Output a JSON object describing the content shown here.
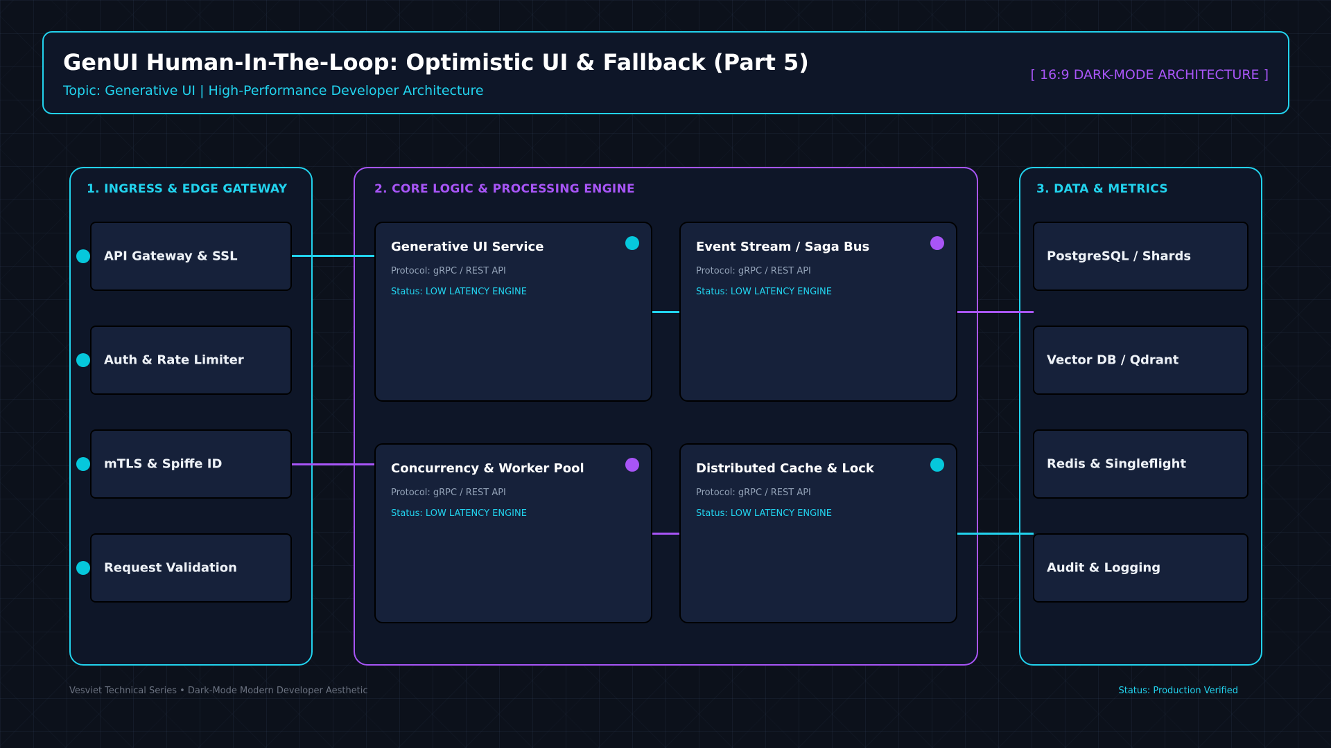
{
  "header": {
    "title": "GenUI Human-In-The-Loop: Optimistic UI & Fallback (Part 5)",
    "subtitle": "Topic: Generative UI | High-Performance Developer Architecture",
    "badge": "[ 16:9 DARK-MODE ARCHITECTURE ]"
  },
  "colors": {
    "background": "#0c111b",
    "panel": "#0e1628",
    "card": "#16213a",
    "cyan": "#22d3ee",
    "purple": "#a855f7"
  },
  "ingress": {
    "title": "1. INGRESS & EDGE GATEWAY",
    "items": [
      {
        "label": "API Gateway & SSL"
      },
      {
        "label": "Auth & Rate Limiter"
      },
      {
        "label": "mTLS & Spiffe ID"
      },
      {
        "label": "Request Validation"
      }
    ]
  },
  "core": {
    "title": "2. CORE LOGIC & PROCESSING ENGINE",
    "services": [
      {
        "title": "Generative UI Service",
        "protocol": "Protocol: gRPC / REST API",
        "status": "Status: LOW LATENCY ENGINE"
      },
      {
        "title": "Event Stream / Saga Bus",
        "protocol": "Protocol: gRPC / REST API",
        "status": "Status: LOW LATENCY ENGINE"
      },
      {
        "title": "Concurrency & Worker Pool",
        "protocol": "Protocol: gRPC / REST API",
        "status": "Status: LOW LATENCY ENGINE"
      },
      {
        "title": "Distributed Cache & Lock",
        "protocol": "Protocol: gRPC / REST API",
        "status": "Status: LOW LATENCY ENGINE"
      }
    ]
  },
  "data_metrics": {
    "title": "3. DATA & METRICS",
    "items": [
      {
        "label": "PostgreSQL / Shards"
      },
      {
        "label": "Vector DB / Qdrant"
      },
      {
        "label": "Redis & Singleflight"
      },
      {
        "label": "Audit & Logging"
      }
    ]
  },
  "footer": {
    "left": "Vesviet Technical Series • Dark-Mode Modern Developer Aesthetic",
    "right": "Status: Production Verified"
  }
}
